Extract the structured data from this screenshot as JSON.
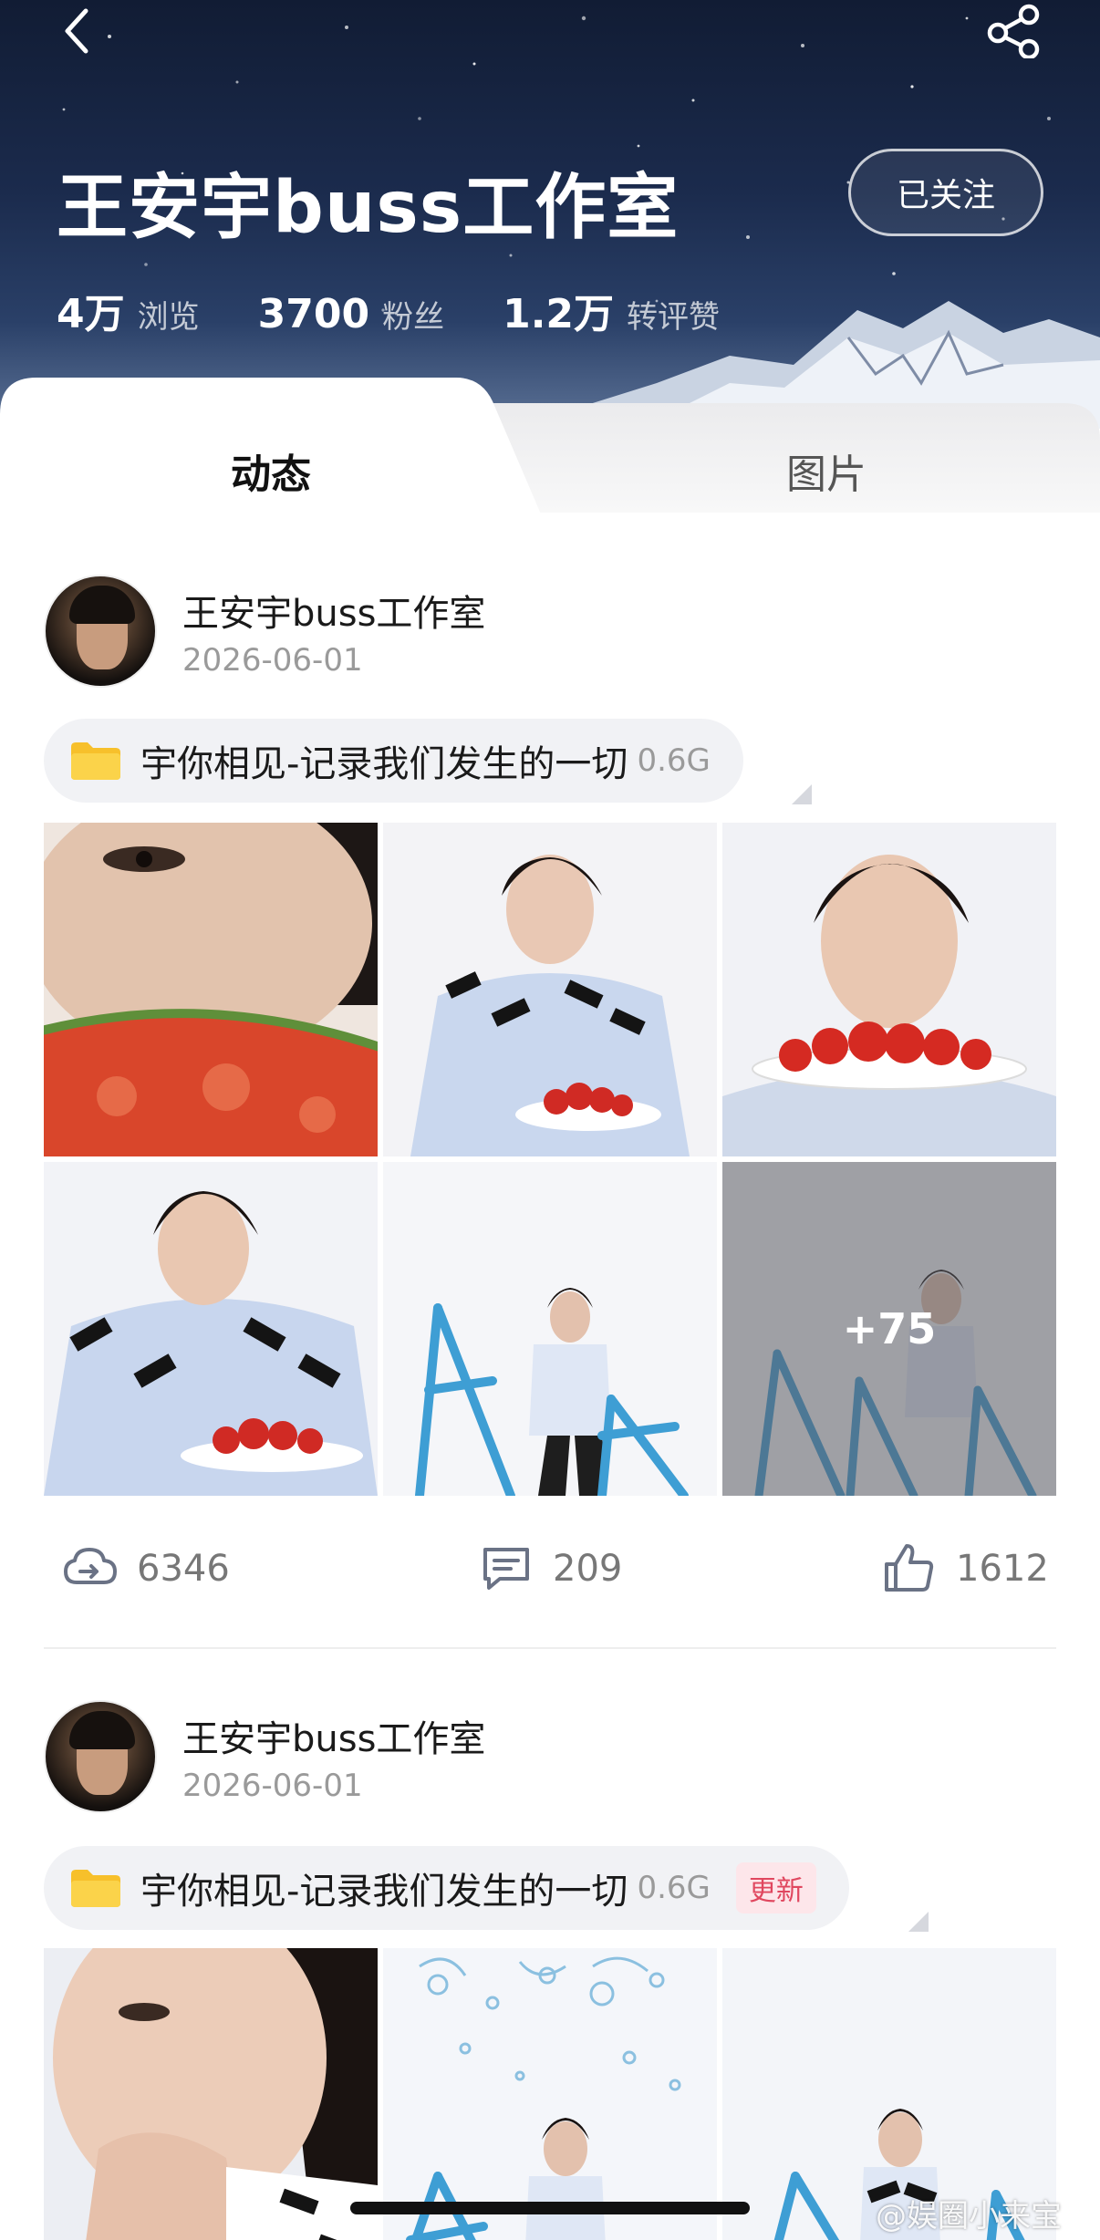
{
  "header": {
    "title": "王安宇buss工作室",
    "follow_label": "已关注",
    "stats": [
      {
        "value": "4万",
        "label": "浏览"
      },
      {
        "value": "3700",
        "label": "粉丝"
      },
      {
        "value": "1.2万",
        "label": "转评赞"
      }
    ]
  },
  "tabs": [
    {
      "label": "动态",
      "active": true
    },
    {
      "label": "图片",
      "active": false
    }
  ],
  "posts": [
    {
      "author": "王安宇buss工作室",
      "date": "2026-06-01",
      "folder_name": "宇你相见-记录我们发生的一切",
      "folder_size": "0.6G",
      "more_count": "+75",
      "downloads": "6346",
      "comments": "209",
      "likes": "1612"
    },
    {
      "author": "王安宇buss工作室",
      "date": "2026-06-01",
      "folder_name": "宇你相见-记录我们发生的一切",
      "folder_size": "0.6G",
      "badge": "更新"
    }
  ],
  "watermark": "@娱圈小来宝",
  "colors": {
    "header_bg": "#1b2b4d",
    "badge_text": "#e0475f",
    "badge_bg": "#fde6ea",
    "folder_yellow": "#f7c02b"
  }
}
